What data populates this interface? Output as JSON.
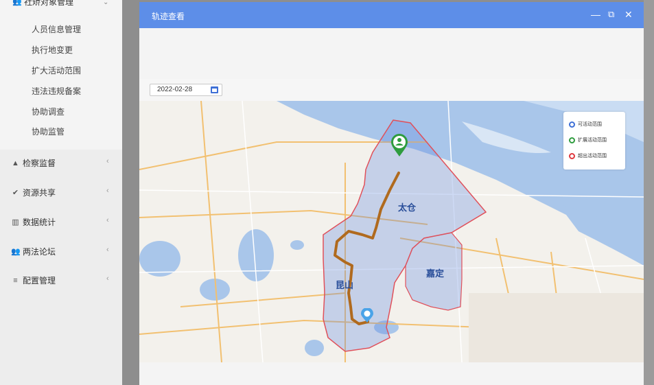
{
  "sidebar": {
    "group_title": "社矫对象管理",
    "sub_items": [
      "人员信息管理",
      "执行地变更",
      "扩大活动范围",
      "违法违规备案",
      "协助调查",
      "协助监管"
    ],
    "items": [
      {
        "label": "检察监督",
        "icon": "warning-icon"
      },
      {
        "label": "资源共享",
        "icon": "check-circle-icon"
      },
      {
        "label": "数据统计",
        "icon": "bar-chart-icon"
      },
      {
        "label": "两法论坛",
        "icon": "users-icon"
      },
      {
        "label": "配置管理",
        "icon": "menu-icon"
      }
    ]
  },
  "modal": {
    "title": "轨迹查看",
    "date_value": "2022-02-28"
  },
  "map": {
    "labels": {
      "taicang": "太仓",
      "kunshan": "昆山",
      "jiading": "嘉定"
    },
    "legend": [
      {
        "label": "可活动范围",
        "color": "#3d6fd6"
      },
      {
        "label": "扩展活动范围",
        "color": "#2e9c3e"
      },
      {
        "label": "超出活动范围",
        "color": "#e0383e"
      }
    ]
  }
}
